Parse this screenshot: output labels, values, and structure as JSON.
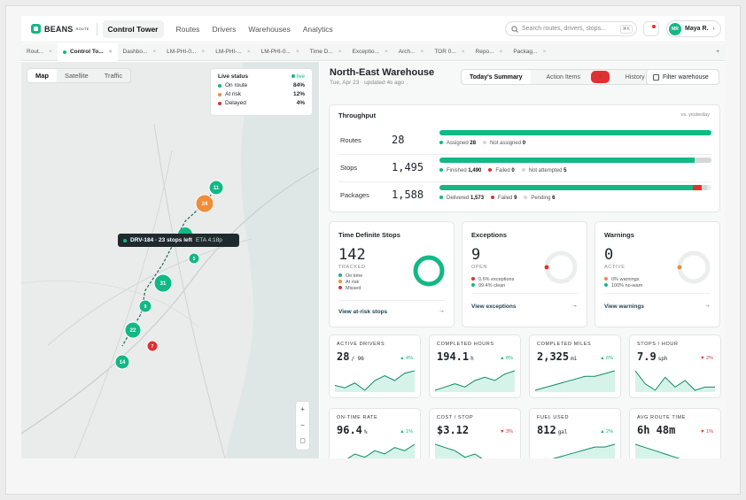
{
  "app": {
    "brand": "BEANS",
    "brand_sub": "ROUTE"
  },
  "nav": {
    "items": [
      "Control Tower",
      "Routes",
      "Drivers",
      "Warehouses",
      "Analytics"
    ],
    "search_placeholder": "Search routes, drivers, stops...",
    "search_kbd": "⌘K",
    "user_initials": "MR",
    "user_name": "Maya R."
  },
  "tabs": [
    "Rout...",
    "Control To...",
    "Dashbo...",
    "LM-PHI-0...",
    "LM-PHI-...",
    "LM-PHI-0...",
    "Time D...",
    "Exceptio...",
    "Arch...",
    "TOR 0...",
    "Repo...",
    "Packag...",
    "+"
  ],
  "map": {
    "views": [
      "Map",
      "Satellite",
      "Traffic"
    ],
    "live": {
      "title": "Live status",
      "badge": "live",
      "rows": [
        {
          "label": "On route",
          "value": "84%",
          "color": "#12b886"
        },
        {
          "label": "At risk",
          "value": "12%",
          "color": "#f08c3a"
        },
        {
          "label": "Delayed",
          "value": "4%",
          "color": "#e03131"
        }
      ]
    },
    "tooltip": {
      "text": "DRV-184 · 23 stops left",
      "eta": "ETA 4:18p"
    },
    "zoom": [
      "+",
      "−",
      "▢"
    ],
    "pins": [
      {
        "label": "11",
        "color": "#12b886"
      },
      {
        "label": "24",
        "color": "#f08c3a"
      },
      {
        "label": "5",
        "color": "#12b886"
      },
      {
        "label": "31",
        "color": "#12b886"
      },
      {
        "label": "9",
        "color": "#12b886"
      },
      {
        "label": "22",
        "color": "#12b886"
      },
      {
        "label": "7",
        "color": "#e03131"
      },
      {
        "label": "14",
        "color": "#12b886"
      }
    ]
  },
  "warehouse": {
    "title": "North-East Warehouse",
    "subtitle": "Tue, Apr 23 · updated 4s ago",
    "views": [
      "Today's Summary",
      "Action Items",
      "History"
    ],
    "action_count": "9",
    "filter": "Filter warehouse"
  },
  "throughput": {
    "title": "Throughput",
    "compare": "vs. yesterday",
    "rows": [
      {
        "name": "Routes",
        "value": "28",
        "segments": [
          {
            "label": "Assigned",
            "value": "28",
            "frac": 1,
            "color": "#12b886"
          },
          {
            "label": "Not assigned",
            "value": "0",
            "frac": 0,
            "color": "#d5d8d8"
          }
        ]
      },
      {
        "name": "Stops",
        "value": "1,495",
        "segments": [
          {
            "label": "Finished",
            "value": "1,490",
            "frac": 0.9367,
            "color": "#12b886"
          },
          {
            "label": "Failed",
            "value": "0",
            "frac": 0,
            "color": "#e03131"
          },
          {
            "label": "Not attempted",
            "value": "5",
            "frac": 0.0633,
            "color": "#d5d8d8"
          }
        ]
      },
      {
        "name": "Packages",
        "value": "1,588",
        "segments": [
          {
            "label": "Delivered",
            "value": "1,573",
            "frac": 0.9328,
            "color": "#12b886"
          },
          {
            "label": "Failed",
            "value": "9",
            "frac": 0.0305,
            "color": "#e03131"
          },
          {
            "label": "Pending",
            "value": "6",
            "frac": 0.0203,
            "color": "#d5d8d8"
          }
        ]
      }
    ]
  },
  "tds": {
    "title": "Time Definite Stops",
    "value": "142",
    "caption": "TRACKED",
    "legend": [
      {
        "label": "On time",
        "color": "#12b886"
      },
      {
        "label": "At risk",
        "color": "#f08c3a"
      },
      {
        "label": "Missed",
        "color": "#e03131"
      }
    ],
    "link": "View at-risk stops",
    "arrow": "→"
  },
  "exceptions": {
    "title": "Exceptions",
    "value": "9",
    "caption": "OPEN",
    "legend": [
      {
        "label": "0.6% exceptions",
        "color": "#e03131"
      },
      {
        "label": "99.4% clean",
        "color": "#12b886"
      }
    ],
    "link": "View exceptions",
    "arrow": "→"
  },
  "warnings": {
    "title": "Warnings",
    "value": "0",
    "caption": "ACTIVE",
    "legend": [
      {
        "label": "0% warnings",
        "color": "#f08c3a"
      },
      {
        "label": "100% no-warn",
        "color": "#12b886"
      }
    ],
    "link": "View warnings",
    "arrow": "→"
  },
  "kpis": [
    {
      "label": "ACTIVE DRIVERS",
      "value": "28",
      "unit": "/ 96",
      "change": "▲ 4%",
      "dir": "up",
      "trend": [
        3,
        2,
        4,
        1,
        5,
        7,
        5,
        8,
        9
      ]
    },
    {
      "label": "COMPLETED HOURS",
      "value": "194.1",
      "unit": "h",
      "change": "▲ 8%",
      "dir": "up",
      "trend": [
        2,
        3,
        4,
        3,
        5,
        6,
        5,
        7,
        8
      ]
    },
    {
      "label": "COMPLETED MILES",
      "value": "2,325",
      "unit": "mi",
      "change": "▲ 6%",
      "dir": "up",
      "trend": [
        1,
        2,
        3,
        4,
        5,
        6,
        6,
        7,
        8
      ]
    },
    {
      "label": "STOPS / HOUR",
      "value": "7.9",
      "unit": "sph",
      "change": "▼ 2%",
      "dir": "dn",
      "trend": [
        8,
        4,
        2,
        6,
        3,
        5,
        2,
        3,
        3
      ]
    },
    {
      "label": "ON-TIME RATE",
      "value": "96.4",
      "unit": "%",
      "change": "▲ 1%",
      "dir": "up",
      "trend": [
        2,
        3,
        5,
        4,
        6,
        5,
        7,
        6,
        8
      ]
    },
    {
      "label": "COST / STOP",
      "value": "$3.12",
      "unit": "",
      "change": "▼ 3%",
      "dir": "dn",
      "trend": [
        8,
        7,
        6,
        4,
        5,
        3,
        3,
        2,
        2
      ]
    },
    {
      "label": "FUEL USED",
      "value": "812",
      "unit": "gal",
      "change": "▲ 2%",
      "dir": "up",
      "trend": [
        1,
        2,
        3,
        4,
        5,
        6,
        7,
        7,
        8
      ]
    },
    {
      "label": "AVG ROUTE TIME",
      "value": "6h 48m",
      "unit": "",
      "change": "▼ 1%",
      "dir": "dn",
      "trend": [
        8,
        7,
        6,
        5,
        4,
        3,
        3,
        2,
        2
      ]
    }
  ]
}
